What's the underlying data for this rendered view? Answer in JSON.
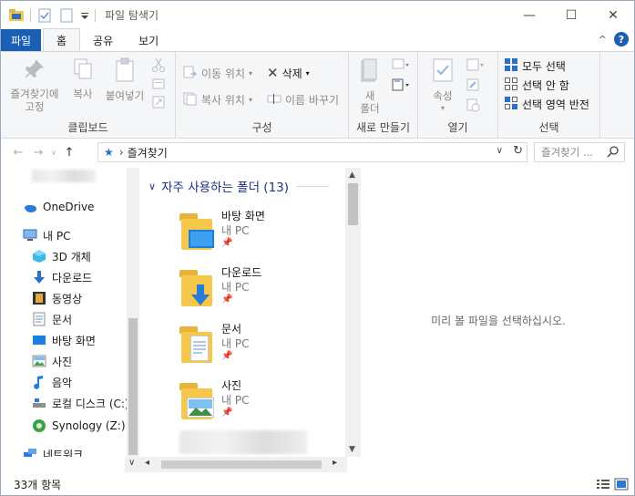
{
  "window": {
    "title": "파일 탐색기",
    "controls": {
      "minimize": "—",
      "maximize": "☐",
      "close": "✕"
    }
  },
  "ribbon_tabs": {
    "file": "파일",
    "home": "홈",
    "share": "공유",
    "view": "보기",
    "collapse": "^",
    "help": "?"
  },
  "ribbon": {
    "clipboard": {
      "label": "클립보드",
      "pin_quick": "즐겨찾기에\n고정",
      "copy": "복사",
      "paste": "붙여넣기"
    },
    "organize": {
      "label": "구성",
      "move_to": "이동 위치",
      "copy_to": "복사 위치",
      "delete": "삭제",
      "rename": "이름 바꾸기"
    },
    "new": {
      "label": "새로 만들기",
      "new_folder": "새\n폴더"
    },
    "open": {
      "label": "열기",
      "properties": "속성"
    },
    "select": {
      "label": "선택",
      "select_all": "모두 선택",
      "select_none": "선택 안 함",
      "invert": "선택 영역 반전"
    }
  },
  "address": {
    "path": "즐겨찾기",
    "search_placeholder": "즐겨찾기 ...",
    "separator": "›"
  },
  "nav": {
    "items": [
      {
        "label": "OneDrive",
        "icon": "cloud-icon"
      },
      {
        "label": "내 PC",
        "icon": "computer-icon"
      },
      {
        "label": "3D 개체",
        "icon": "cube-icon"
      },
      {
        "label": "다운로드",
        "icon": "download-icon"
      },
      {
        "label": "동영상",
        "icon": "video-icon"
      },
      {
        "label": "문서",
        "icon": "document-icon"
      },
      {
        "label": "바탕 화면",
        "icon": "desktop-icon"
      },
      {
        "label": "사진",
        "icon": "picture-icon"
      },
      {
        "label": "음악",
        "icon": "music-icon"
      },
      {
        "label": "로컬 디스크 (C:)",
        "icon": "drive-icon"
      },
      {
        "label": "Synology (Z:)",
        "icon": "network-drive-icon"
      },
      {
        "label": "네트워크",
        "icon": "network-icon"
      }
    ]
  },
  "main": {
    "section_title": "자주 사용하는 폴더 (13)",
    "section_chevron": "∨",
    "folders": [
      {
        "name": "바탕 화면",
        "location": "내 PC",
        "overlay": "desktop"
      },
      {
        "name": "다운로드",
        "location": "내 PC",
        "overlay": "download"
      },
      {
        "name": "문서",
        "location": "내 PC",
        "overlay": "document"
      },
      {
        "name": "사진",
        "location": "내 PC",
        "overlay": "picture"
      }
    ]
  },
  "preview": {
    "message": "미리 볼 파일을 선택하십시오."
  },
  "status": {
    "count": "33개 항목"
  },
  "colors": {
    "accent": "#1a5fb4",
    "folder": "#f5c84c",
    "section": "#1e3287"
  }
}
